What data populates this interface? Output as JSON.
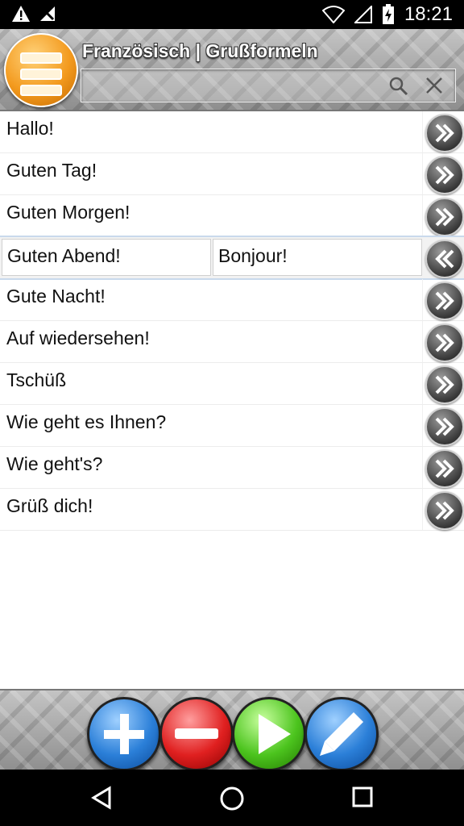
{
  "status_bar": {
    "time": "18:21",
    "icons": [
      "warning-icon",
      "no-signal-icon",
      "wifi-icon",
      "signal-icon",
      "battery-icon"
    ]
  },
  "header": {
    "title": "Französisch | Grußformeln",
    "search": {
      "value": "",
      "placeholder": ""
    },
    "icons": [
      "menu-icon",
      "search-icon",
      "close-icon"
    ]
  },
  "list": {
    "items": [
      {
        "label": "Hallo!",
        "expanded": false
      },
      {
        "label": "Guten Tag!",
        "expanded": false
      },
      {
        "label": "Guten Morgen!",
        "expanded": false
      },
      {
        "label": "Guten Abend!",
        "translation": "Bonjour!",
        "expanded": true
      },
      {
        "label": "Gute Nacht!",
        "expanded": false
      },
      {
        "label": "Auf wiedersehen!",
        "expanded": false
      },
      {
        "label": "Tschüß",
        "expanded": false
      },
      {
        "label": "Wie geht es Ihnen?",
        "expanded": false
      },
      {
        "label": "Wie geht's?",
        "expanded": false
      },
      {
        "label": "Grüß dich!",
        "expanded": false
      }
    ]
  },
  "footer": {
    "buttons": [
      "plus-icon",
      "minus-icon",
      "play-icon",
      "pencil-icon"
    ]
  },
  "nav_bar": {
    "buttons": [
      "back-icon",
      "home-icon",
      "recents-icon"
    ]
  }
}
